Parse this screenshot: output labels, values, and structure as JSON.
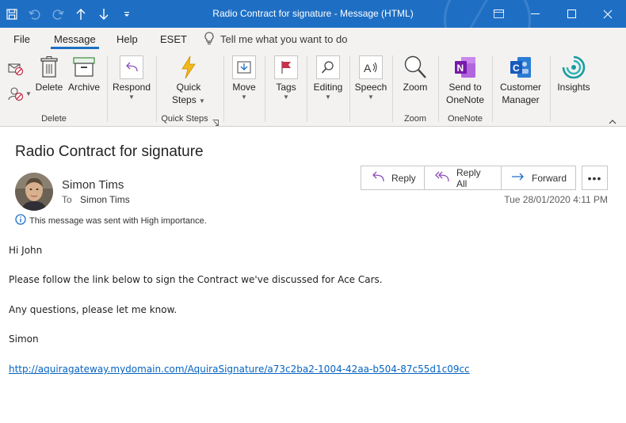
{
  "window": {
    "title": "Radio Contract for signature  -  Message (HTML)"
  },
  "menu": {
    "tabs": [
      "File",
      "Message",
      "Help",
      "ESET"
    ],
    "active": "Message",
    "tell_me": "Tell me what you want to do"
  },
  "ribbon": {
    "delete_label": "Delete",
    "archive_label": "Archive",
    "group_delete": "Delete",
    "respond_label": "Respond",
    "quick_steps_line1": "Quick",
    "quick_steps_line2": "Steps",
    "group_quick_steps": "Quick Steps",
    "move_label": "Move",
    "tags_label": "Tags",
    "editing_label": "Editing",
    "speech_label": "Speech",
    "zoom_label": "Zoom",
    "group_zoom": "Zoom",
    "send_onenote_line1": "Send to",
    "send_onenote_line2": "OneNote",
    "group_onenote": "OneNote",
    "customer_line1": "Customer",
    "customer_line2": "Manager",
    "insights_label": "Insights"
  },
  "message": {
    "subject": "Radio Contract for signature",
    "sender": "Simon Tims",
    "to_label": "To",
    "to_name": "Simon Tims",
    "importance": "This message was sent with High importance.",
    "date": "Tue 28/01/2020 4:11 PM",
    "reply_label": "Reply",
    "reply_all_label": "Reply All",
    "forward_label": "Forward",
    "more_label": "•••",
    "body": {
      "greeting": "Hi John",
      "line1": "Please follow the link below to sign the Contract we've discussed for Ace Cars.",
      "line2": "Any questions, please let me know.",
      "signoff": "Simon",
      "link": "http://aquiragateway.mydomain.com/AquiraSignature/a73c2ba2-1004-42aa-b504-87c55d1c09cc"
    }
  },
  "colors": {
    "titlebar": "#1e6fc4",
    "ribbon_bg": "#f3f2f1",
    "link": "#0563c1",
    "onenote": "#7719aa",
    "insights": "#1a9ba1",
    "quick_steps": "#f2b91c",
    "flag": "#c4314b"
  }
}
